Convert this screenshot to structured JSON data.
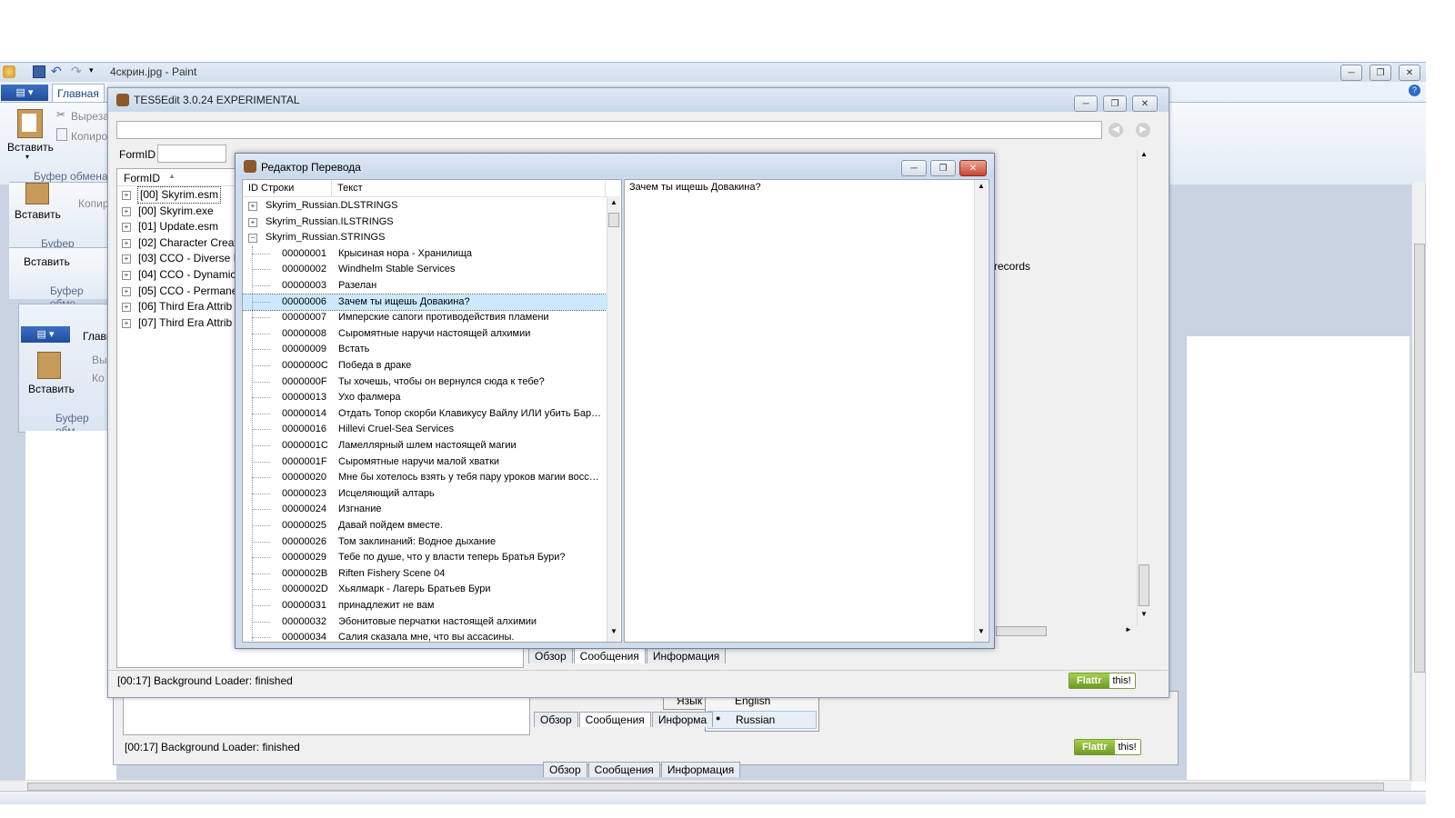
{
  "paint": {
    "title": "4скрин.jpg - Paint",
    "ribbon_tab_home": "Главная",
    "paste_label": "Вставить",
    "cut_label": "Выреза",
    "copy_label": "Копиро",
    "clipboard_group": "Буфер обмена",
    "paste_label2": "Вставить",
    "copy_label2": "Копир",
    "clipboard_group2": "Буфер обмена",
    "paste_label3": "Вставить",
    "clipboard_group3": "Буфер обме",
    "ribbon_tab_home2": "Главн",
    "paste_label4": "Вставить",
    "cut_label4": "Вы",
    "copy_label4": "Ко",
    "clipboard_group4": "Буфер обм"
  },
  "tes5edit": {
    "title": "TES5Edit 3.0.24 EXPERIMENTAL",
    "formid_label": "FormID",
    "column_formid": "FormID",
    "plugins": [
      "[00] Skyrim.esm",
      "[00] Skyrim.exe",
      "[01] Update.esm",
      "[02] Character Creat",
      "[03] CCO - Diverse R",
      "[04] CCO - Dynamic",
      "[05] CCO - Permane",
      "[06] Third Era Attrib",
      "[07] Third Era Attrib"
    ],
    "records_text": "records",
    "tabs": [
      "Обзор",
      "Сообщения",
      "Информация"
    ],
    "status": "[00:17] Background Loader: finished",
    "flattr_label": "Flattr",
    "flattr_this": "this!"
  },
  "back_window": {
    "menu_language": "Язык",
    "lang_english": "English",
    "lang_russian": "Russian",
    "tabs": [
      "Обзор",
      "Сообщения",
      "Информа"
    ],
    "status": "[00:17] Background Loader: finished",
    "flattr_label": "Flattr",
    "flattr_this": "this!",
    "tabs_bottom": [
      "Обзор",
      "Сообщения",
      "Информация"
    ]
  },
  "translator": {
    "title": "Редактор Перевода",
    "col_id": "ID Строки",
    "col_text": "Текст",
    "groups": [
      "Skyrim_Russian.DLSTRINGS",
      "Skyrim_Russian.ILSTRINGS",
      "Skyrim_Russian.STRINGS"
    ],
    "rows": [
      {
        "id": "00000001",
        "text": "Крысиная нора - Хранилища"
      },
      {
        "id": "00000002",
        "text": "Windhelm Stable Services"
      },
      {
        "id": "00000003",
        "text": "Разелан"
      },
      {
        "id": "00000006",
        "text": "Зачем ты ищешь Довакина?"
      },
      {
        "id": "00000007",
        "text": "Имперские сапоги противодействия пламени"
      },
      {
        "id": "00000008",
        "text": "Сыромятные наручи настоящей алхимии"
      },
      {
        "id": "00000009",
        "text": "Встать"
      },
      {
        "id": "0000000C",
        "text": "Победа в драке"
      },
      {
        "id": "0000000F",
        "text": "Ты хочешь, чтобы он вернулся сюда к тебе?"
      },
      {
        "id": "00000013",
        "text": "Ухо фалмера"
      },
      {
        "id": "00000014",
        "text": "Отдать Топор скорби Клавикусу Вайлу ИЛИ убить Бар…"
      },
      {
        "id": "00000016",
        "text": "Hillevi Cruel-Sea Services"
      },
      {
        "id": "0000001C",
        "text": "Ламеллярный шлем настоящей магии"
      },
      {
        "id": "0000001F",
        "text": "Сыромятные наручи малой хватки"
      },
      {
        "id": "00000020",
        "text": "Мне бы хотелось взять у тебя пару уроков магии восс…"
      },
      {
        "id": "00000023",
        "text": "Исцеляющий алтарь"
      },
      {
        "id": "00000024",
        "text": "Изгнание"
      },
      {
        "id": "00000025",
        "text": "Давай пойдем вместе."
      },
      {
        "id": "00000026",
        "text": "Том заклинаний: Водное дыхание"
      },
      {
        "id": "00000029",
        "text": "Тебе по душе, что у власти теперь Братья Бури?"
      },
      {
        "id": "0000002B",
        "text": "Riften Fishery Scene 04"
      },
      {
        "id": "0000002D",
        "text": "Хьялмарк - Лагерь Братьев Бури"
      },
      {
        "id": "00000031",
        "text": "принадлежит не вам"
      },
      {
        "id": "00000032",
        "text": "Эбонитовые перчатки настоящей алхимии"
      },
      {
        "id": "00000034",
        "text": "Салия сказала мне, что вы ассасины."
      }
    ],
    "selected_index": 3,
    "preview_text": "Зачем ты ищешь Довакина?"
  },
  "icons": [
    "save-icon",
    "undo-icon",
    "redo-icon",
    "paste-icon",
    "cut-icon",
    "copy-icon",
    "help-icon",
    "app-icon"
  ],
  "colors": {
    "selection": "#cce8ff",
    "titlebar": "#c9d9ec",
    "close": "#c8452e",
    "flattr_green": "#6c9b24"
  }
}
